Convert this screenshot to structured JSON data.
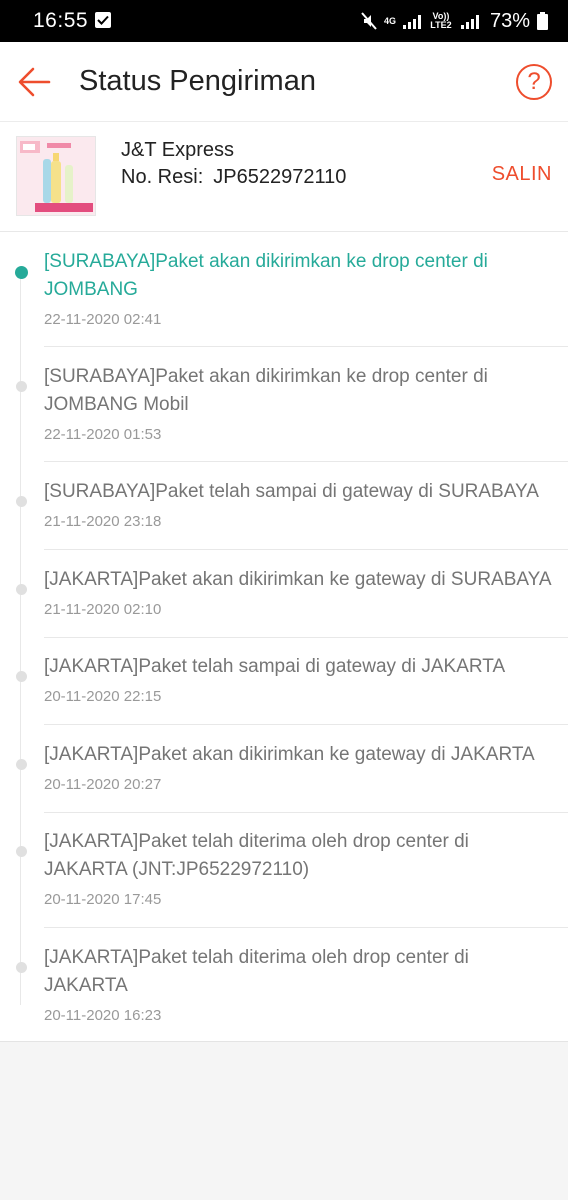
{
  "status_bar": {
    "time": "16:55",
    "network_label": "4G",
    "volte_label": "Vo)) LTE2",
    "battery": "73%"
  },
  "header": {
    "title": "Status Pengiriman",
    "back_icon": "arrow-left-icon",
    "help_icon": "question-circle-icon",
    "help_glyph": "?",
    "accent_color": "#ee4d2d"
  },
  "shipment": {
    "courier": "J&T Express",
    "resi_label": "No. Resi:",
    "resi_number": "JP6522972110",
    "copy_label": "SALIN"
  },
  "timeline": {
    "current_color": "#26aa99",
    "events": [
      {
        "message": "[SURABAYA]Paket akan dikirimkan ke drop center di JOMBANG",
        "timestamp": "22-11-2020 02:41",
        "current": true
      },
      {
        "message": "[SURABAYA]Paket akan dikirimkan ke drop center di JOMBANG Mobil",
        "timestamp": "22-11-2020 01:53",
        "current": false
      },
      {
        "message": "[SURABAYA]Paket telah sampai di gateway di SURABAYA",
        "timestamp": "21-11-2020 23:18",
        "current": false
      },
      {
        "message": "[JAKARTA]Paket akan dikirimkan ke gateway di SURABAYA",
        "timestamp": "21-11-2020 02:10",
        "current": false
      },
      {
        "message": "[JAKARTA]Paket telah sampai di gateway di JAKARTA",
        "timestamp": "20-11-2020 22:15",
        "current": false
      },
      {
        "message": "[JAKARTA]Paket akan dikirimkan ke gateway di JAKARTA",
        "timestamp": "20-11-2020 20:27",
        "current": false
      },
      {
        "message": "[JAKARTA]Paket telah diterima oleh drop center di JAKARTA (JNT:JP6522972110)",
        "timestamp": "20-11-2020 17:45",
        "current": false
      },
      {
        "message": "[JAKARTA]Paket telah diterima oleh drop center di JAKARTA",
        "timestamp": "20-11-2020 16:23",
        "current": false
      }
    ]
  }
}
